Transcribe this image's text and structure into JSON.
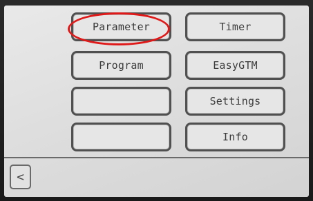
{
  "menu": {
    "parameter": "Parameter",
    "timer": "Timer",
    "program": "Program",
    "easygtm": "EasyGTM",
    "empty_left_3": "",
    "settings": "Settings",
    "empty_left_4": "",
    "info": "Info"
  },
  "nav": {
    "back_glyph": "<"
  },
  "annotation": {
    "highlight_color": "#e01818"
  }
}
